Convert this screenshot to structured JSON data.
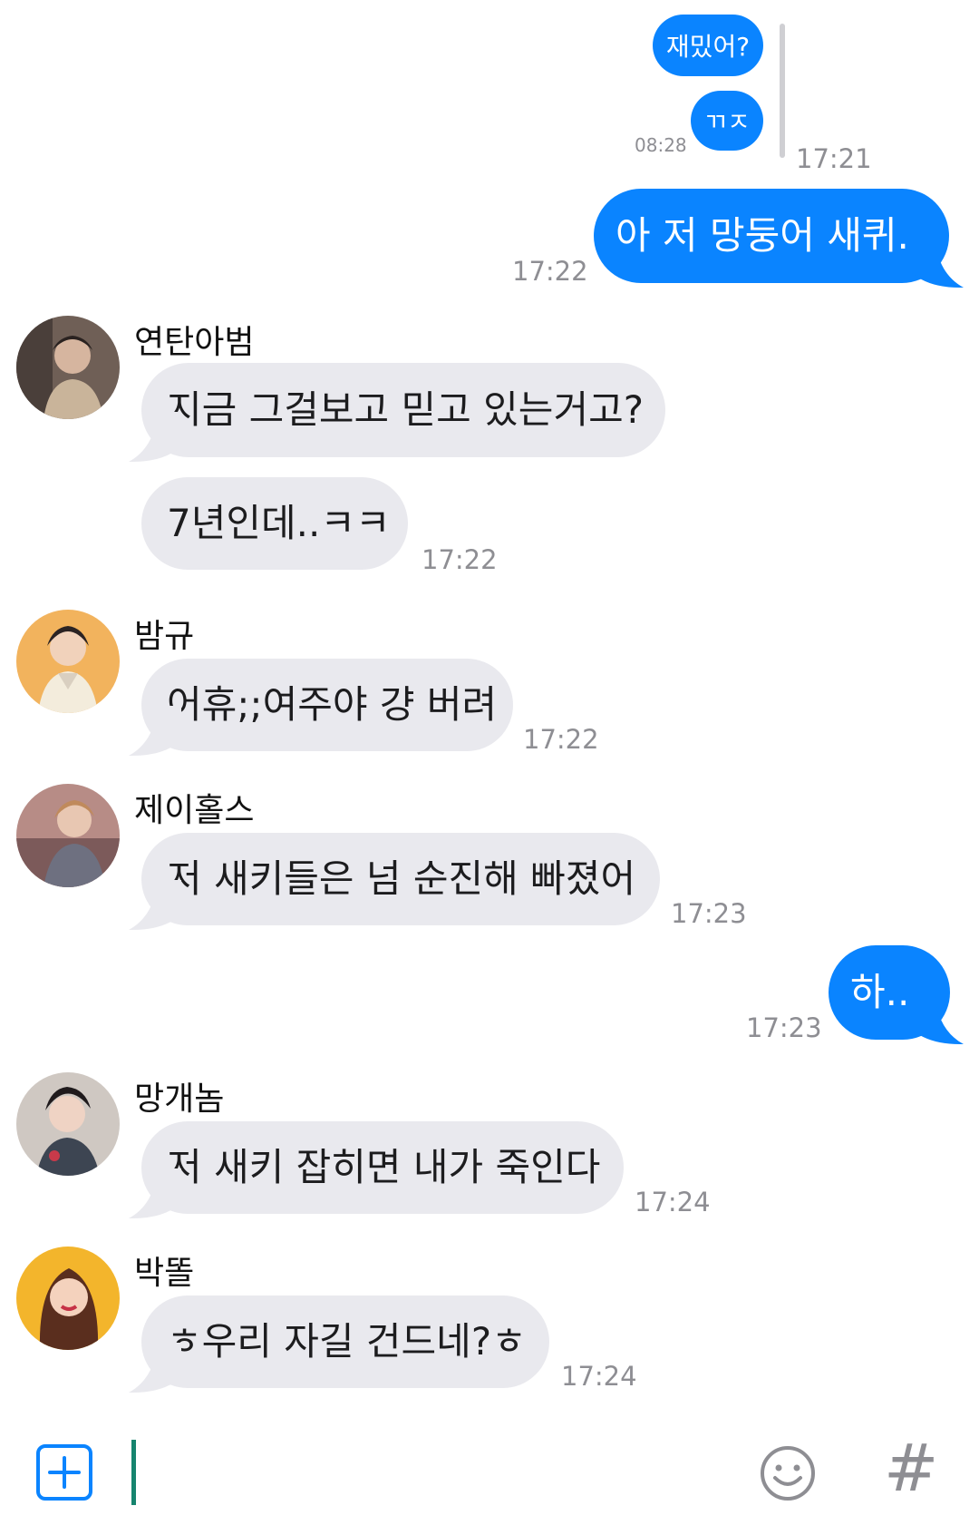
{
  "reply_preview": {
    "bubbles": [
      "재밌어?",
      "ㄲㅈ"
    ],
    "time": "08:28"
  },
  "messages": [
    {
      "direction": "out",
      "text": "아 저 망둥어 새퀴.,.",
      "time": "17:22"
    },
    {
      "direction": "in",
      "sender": "연탄아범",
      "texts": [
        "지금 그걸보고 믿고 있는거고?",
        "7년인데..ㅋㅋ"
      ],
      "time": "17:22"
    },
    {
      "direction": "in",
      "sender": "밤규",
      "texts": [
        "어휴;;여주야 걍 버려"
      ],
      "time": "17:22"
    },
    {
      "direction": "in",
      "sender": "제이홀스",
      "texts": [
        "저 새키들은 넘 순진해 빠졌어"
      ],
      "time": "17:23"
    },
    {
      "direction": "out",
      "text": "하....",
      "time": "17:23"
    },
    {
      "direction": "in",
      "sender": "망개놈",
      "texts": [
        "저 새키 잡히면 내가 죽인다"
      ],
      "time": "17:24"
    },
    {
      "direction": "in",
      "sender": "박똘",
      "texts": [
        "ㅎ우리 자길 건드네?ㅎ"
      ],
      "time": "17:24"
    }
  ],
  "reply_time": "17:21",
  "composer": {
    "add_icon": "plus-square-icon",
    "emoji_icon": "smiley-icon",
    "hashtag_label": "#"
  },
  "colors": {
    "outgoing_bubble": "#0a84ff",
    "incoming_bubble": "#e9e9ee",
    "timestamp": "#8e8e93",
    "caret": "#16846e"
  }
}
